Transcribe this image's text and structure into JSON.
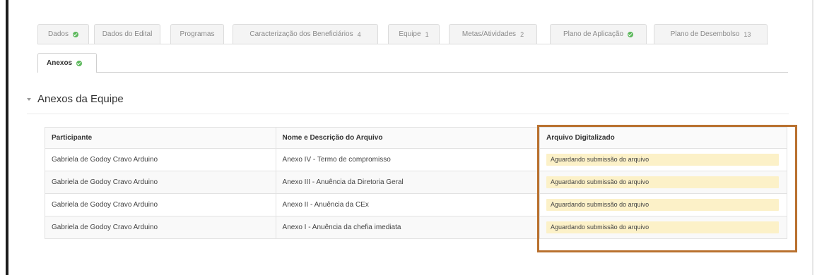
{
  "tabs": [
    {
      "label": "Dados",
      "check": true,
      "count": ""
    },
    {
      "label": "Dados do Edital",
      "check": false,
      "count": ""
    },
    {
      "label": "Programas",
      "check": false,
      "count": ""
    },
    {
      "label": "Caracterização dos Beneficiários",
      "check": false,
      "count": "4"
    },
    {
      "label": "Equipe",
      "check": false,
      "count": "1"
    },
    {
      "label": "Metas/Atividades",
      "check": false,
      "count": "2"
    },
    {
      "label": "Plano de Aplicação",
      "check": true,
      "count": ""
    },
    {
      "label": "Plano de Desembolso",
      "check": false,
      "count": "13"
    }
  ],
  "active_tab": {
    "label": "Anexos",
    "check": true
  },
  "section": {
    "title": "Anexos da Equipe"
  },
  "table": {
    "headers": [
      "Participante",
      "Nome e Descrição do Arquivo",
      "Arquivo Digitalizado"
    ],
    "rows": [
      {
        "participant": "Gabriela de Godoy Cravo Arduino",
        "file": "Anexo IV - Termo de compromisso",
        "status": "Aguardando submissão do arquivo"
      },
      {
        "participant": "Gabriela de Godoy Cravo Arduino",
        "file": "Anexo III - Anuência da Diretoria Geral",
        "status": "Aguardando submissão do arquivo"
      },
      {
        "participant": "Gabriela de Godoy Cravo Arduino",
        "file": "Anexo II - Anuência da CEx",
        "status": "Aguardando submissão do arquivo"
      },
      {
        "participant": "Gabriela de Godoy Cravo Arduino",
        "file": "Anexo I - Anuência da chefia imediata",
        "status": "Aguardando submissão do arquivo"
      }
    ]
  },
  "colors": {
    "check": "#5cb85c",
    "status_bg": "#fcf1c8",
    "highlight": "#b9712f"
  }
}
